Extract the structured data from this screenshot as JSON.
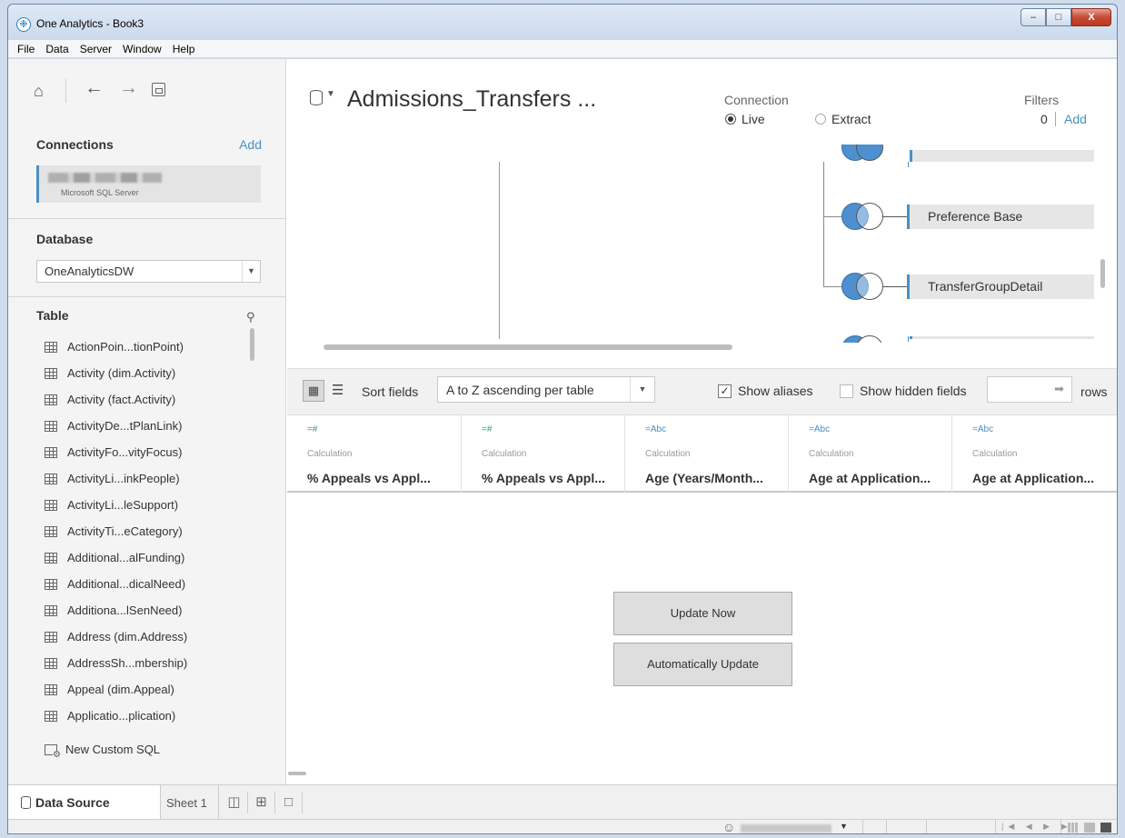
{
  "window": {
    "title": "One Analytics - Book3",
    "minimize": "–",
    "maximize": "□",
    "close": "X"
  },
  "menu": [
    "File",
    "Data",
    "Server",
    "Window",
    "Help"
  ],
  "left": {
    "connections_title": "Connections",
    "add_label": "Add",
    "connection_type": "Microsoft SQL Server",
    "database_title": "Database",
    "database_value": "OneAnalyticsDW",
    "table_title": "Table",
    "tables": [
      "ActionPoin...tionPoint)",
      "Activity (dim.Activity)",
      "Activity (fact.Activity)",
      "ActivityDe...tPlanLink)",
      "ActivityFo...vityFocus)",
      "ActivityLi...inkPeople)",
      "ActivityLi...leSupport)",
      "ActivityTi...eCategory)",
      "Additional...alFunding)",
      "Additional...dicalNeed)",
      "Additiona...lSenNeed)",
      "Address (dim.Address)",
      "AddressSh...mbership)",
      "Appeal (dim.Appeal)",
      "Applicatio...plication)"
    ],
    "new_custom_sql": "New Custom SQL"
  },
  "datasource": {
    "title": "Admissions_Transfers ...",
    "connection_label": "Connection",
    "live_label": "Live",
    "extract_label": "Extract",
    "connection_mode": "Live",
    "filters_label": "Filters",
    "filters_count": "0",
    "filters_add": "Add",
    "joined_tables": [
      "Preference Base",
      "TransferGroupDetail"
    ]
  },
  "toolbar": {
    "sort_label": "Sort fields",
    "sort_value": "A to Z ascending per table",
    "show_aliases": "Show aliases",
    "show_aliases_checked": true,
    "show_hidden": "Show hidden fields",
    "show_hidden_checked": false,
    "rows_label": "rows"
  },
  "columns": [
    {
      "type": "=#",
      "kind": "Calculation",
      "name": "% Appeals vs Appl..."
    },
    {
      "type": "=#",
      "kind": "Calculation",
      "name": "% Appeals vs Appl..."
    },
    {
      "type": "=Abc",
      "kind": "Calculation",
      "name": "Age (Years/Month..."
    },
    {
      "type": "=Abc",
      "kind": "Calculation",
      "name": "Age at Application..."
    },
    {
      "type": "=Abc",
      "kind": "Calculation",
      "name": "Age at Application..."
    }
  ],
  "buttons": {
    "update_now": "Update Now",
    "auto_update": "Automatically Update"
  },
  "tabs": {
    "data_source": "Data Source",
    "sheet1": "Sheet 1"
  },
  "colors": {
    "accent": "#4a90c2",
    "join_fill": "#4e8fcf",
    "calc_number": "#2e9e6c",
    "calc_string": "#4a90c2"
  }
}
